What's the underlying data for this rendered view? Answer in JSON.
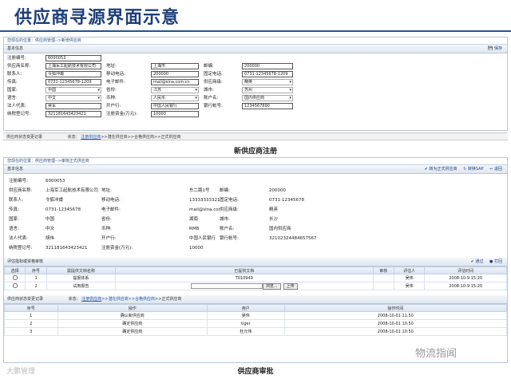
{
  "title": "供应商寻源界面示意",
  "reg": {
    "breadcrumb": "您现在的位置：供应商管理-->新增供应商",
    "section": "基本信息",
    "save": "保存",
    "fields": [
      [
        "注册编号:",
        "6000053",
        "",
        "",
        "",
        "",
        "",
        ""
      ],
      [
        "供应商名称:",
        "上海军工起航技术有限公司",
        "地址:",
        "上海市",
        "邮编:",
        "200000",
        "",
        ""
      ],
      [
        "联系人:",
        "令狐冲甫",
        "移动电话:",
        "200000",
        "固定电话:",
        "0731-12345678-1209",
        "",
        ""
      ],
      [
        "传真:",
        "0731-12345678-1209",
        "电子邮件:",
        "mail@sina.com.cn",
        "供应商级:",
        "精英",
        "",
        ""
      ],
      [
        "国家:",
        "中国",
        "省份:",
        "江苏",
        "城市:",
        "苏州",
        "",
        ""
      ],
      [
        "语言:",
        "中文",
        "币种:",
        "人民币",
        "账户名:",
        "国内供应商",
        "",
        ""
      ],
      [
        "法人代表:",
        "吴军",
        "开户行:",
        "中国人民银行",
        "银行帐号:",
        "1234567890",
        "",
        ""
      ],
      [
        "纳税登记号:",
        "321181643423421",
        "注册资金(万元):",
        "10000",
        "",
        "",
        "",
        ""
      ]
    ],
    "status_label": "供应商状态变更记录",
    "status_text": "状态：",
    "flow": [
      "注册供应商",
      ">>潜在供应商",
      ">>合格供应商",
      ">>正式供应商"
    ]
  },
  "cap1": "新供应商注册",
  "audit": {
    "breadcrumb": "您现在的位置：供应商管理-->审核正式供应商",
    "section": "基本信息",
    "actions": [
      "转为正式供应商",
      "转换SAP",
      "退回"
    ],
    "fields": [
      [
        "注册编号:",
        "6000053",
        "",
        "",
        "",
        "",
        "",
        ""
      ],
      [
        "供应商名称:",
        "上海军工起航技术有限公司",
        "地址:",
        "东二路1号",
        "邮编:",
        "200000",
        "",
        ""
      ],
      [
        "联系人:",
        "令狐冲甫",
        "移动电话:",
        "13333333321",
        "固定电话:",
        "0731-12345678",
        "",
        ""
      ],
      [
        "传真:",
        "0731-12345678",
        "电子邮件:",
        "mail@sina.com.cn",
        "供应商级:",
        "精英",
        "",
        ""
      ],
      [
        "国家:",
        "中国",
        "省份:",
        "湖南",
        "城市:",
        "长沙",
        "",
        ""
      ],
      [
        "语言:",
        "中文",
        "币种:",
        "RMB",
        "账户名:",
        "国内供应商",
        "",
        ""
      ],
      [
        "法人代表:",
        "胡伟",
        "开户行:",
        "中国人民银行",
        "银行帐号:",
        "32102324484657567",
        "",
        ""
      ],
      [
        "纳税登记号:",
        "321181643423421",
        "注册资金(万元):",
        "10000",
        "",
        "",
        "",
        ""
      ]
    ],
    "eval_label": "评估指标或资格审核",
    "eval_actions": [
      "通过",
      "打回"
    ],
    "eval_headers": [
      "选择",
      "序号",
      "需提供文档名称",
      "已提供文档",
      "审核",
      "评估人",
      "评估时间"
    ],
    "eval_rows": [
      [
        "",
        "1",
        "提报体系",
        "T010949",
        "",
        "吴伟",
        "2008-10-9 15:20"
      ],
      [
        "",
        "2",
        "试用报告",
        "",
        "",
        "吴伟",
        "2008-10-9 15:20"
      ]
    ],
    "browse": "浏览...",
    "upload": "上传",
    "log_label": "供应商状态变更记录",
    "log_headers": [
      "序号",
      "操作",
      "用户",
      "操作时间"
    ],
    "log_rows": [
      [
        "1",
        "确认新供应商",
        "吴伟",
        "2008-10-01 11:50"
      ],
      [
        "2",
        "确定供应商",
        "tiger",
        "2008-10-01 10:50"
      ],
      [
        "3",
        "确定供应商",
        "杜元伟",
        "2008-10-01 10:50"
      ]
    ]
  },
  "cap2": "供应商审批",
  "wm1": "大鹏管理",
  "wm2": "物流指闻"
}
